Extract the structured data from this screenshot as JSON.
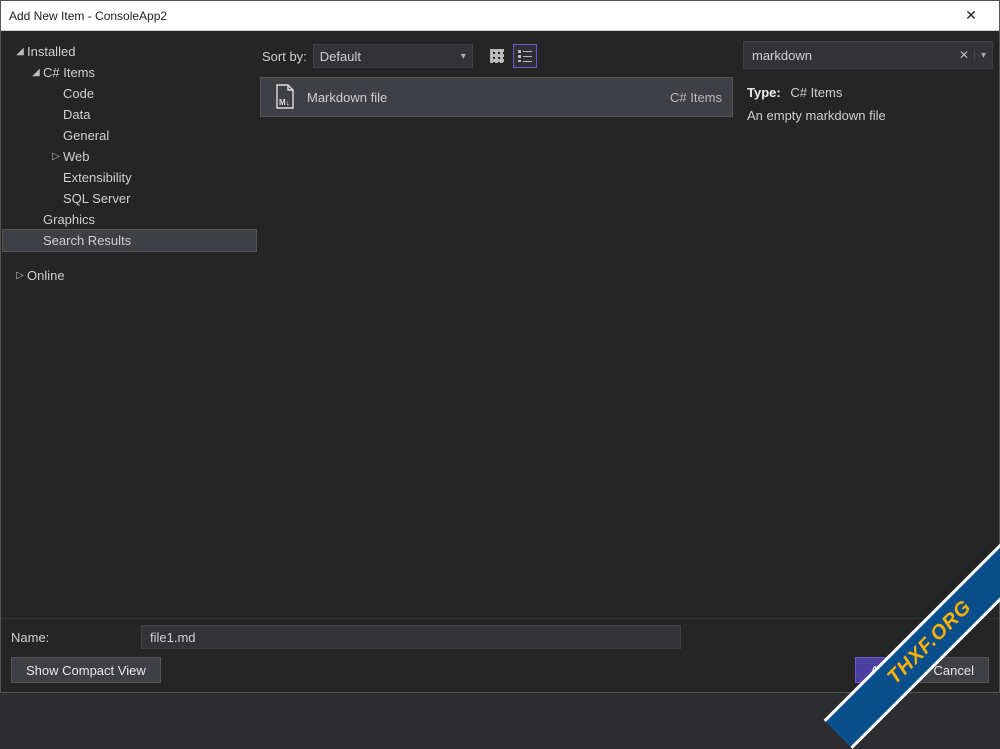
{
  "window": {
    "title": "Add New Item - ConsoleApp2"
  },
  "sidebar": {
    "installed": "Installed",
    "csitems": "C# Items",
    "code": "Code",
    "data": "Data",
    "general": "General",
    "web": "Web",
    "extensibility": "Extensibility",
    "sqlserver": "SQL Server",
    "graphics": "Graphics",
    "searchresults": "Search Results",
    "online": "Online"
  },
  "toolbar": {
    "sort_label": "Sort by:",
    "sort_value": "Default"
  },
  "templates": {
    "items": [
      {
        "name": "Markdown file",
        "category": "C# Items"
      }
    ]
  },
  "search": {
    "value": "markdown"
  },
  "details": {
    "type_label": "Type:",
    "type_value": "C# Items",
    "description": "An empty markdown file"
  },
  "bottom": {
    "name_label": "Name:",
    "name_value": "file1.md",
    "compact_view": "Show Compact View",
    "add": "Add",
    "cancel": "Cancel"
  },
  "watermark": "THXF.ORG"
}
